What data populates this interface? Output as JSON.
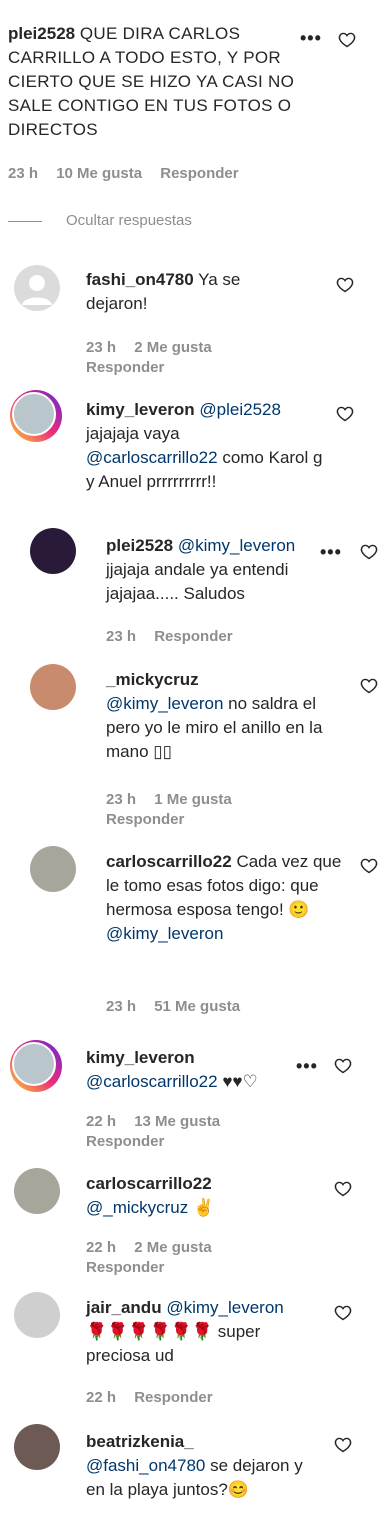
{
  "top": {
    "username": "plei2528",
    "text": "QUE DIRA CARLOS CARRILLO A TODO ESTO, Y POR CIERTO QUE SE HIZO YA CASI NO SALE CONTIGO EN TUS FOTOS O DIRECTOS",
    "time": "23 h",
    "likes": "10 Me gusta",
    "reply": "Responder"
  },
  "hide_replies": "Ocultar respuestas",
  "comments": [
    {
      "username": "fashi_on4780",
      "text": "Ya se dejaron!",
      "time": "23 h",
      "likes": "2 Me gusta",
      "reply": "Responder"
    },
    {
      "username": "kimy_leveron",
      "mention": "@plei2528",
      "text1": "jajajaja vaya",
      "mention2": "@carloscarrillo22",
      "text2": "como Karol g y Anuel prrrrrrrrr!!"
    },
    {
      "username": "plei2528",
      "mention": "@kimy_leveron",
      "text": "jjajaja andale ya entendi jajajaa..... Saludos",
      "time": "23 h",
      "reply": "Responder"
    },
    {
      "username": "_mickycruz",
      "mention": "@kimy_leveron",
      "text": "no saldra el pero yo le miro el anillo en la mano ▯▯",
      "time": "23 h",
      "likes": "1 Me gusta",
      "reply": "Responder"
    },
    {
      "username": "carloscarrillo22",
      "text": "Cada vez que le tomo esas fotos digo: que hermosa esposa tengo! 🙂",
      "mention": "@kimy_leveron",
      "time": "23 h",
      "likes": "51 Me gusta"
    },
    {
      "username": "kimy_leveron",
      "mention": "@carloscarrillo22",
      "hearts": "♥♥♡",
      "time": "22 h",
      "likes": "13 Me gusta",
      "reply": "Responder"
    },
    {
      "username": "carloscarrillo22",
      "mention": "@_mickycruz",
      "emoji": "✌",
      "time": "22 h",
      "likes": "2 Me gusta",
      "reply": "Responder"
    },
    {
      "username": "jair_andu",
      "mention": "@kimy_leveron",
      "roses": "🌹🌹🌹🌹🌹🌹",
      "text": "super preciosa ud",
      "time": "22 h",
      "reply": "Responder"
    },
    {
      "username": "beatrizkenia_",
      "mention": "@fashi_on4780",
      "text": "se dejaron y en la playa juntos?😊"
    }
  ],
  "icons": {
    "heart": "heart-icon",
    "more": "more-icon"
  }
}
